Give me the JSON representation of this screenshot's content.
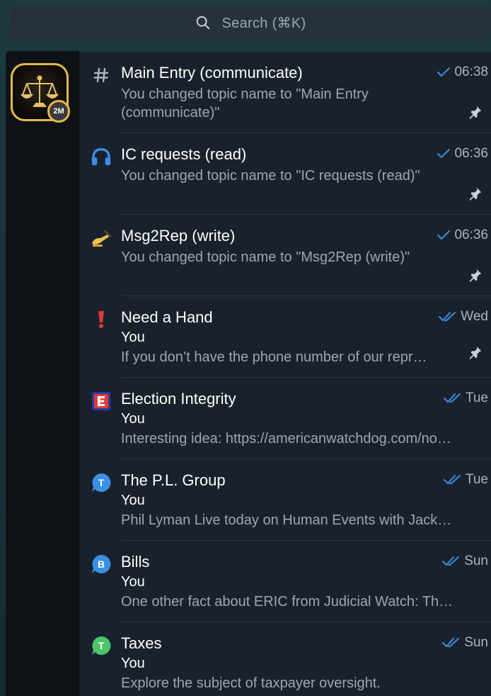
{
  "search": {
    "placeholder": "Search (⌘K)"
  },
  "sidebar": {
    "group_avatar": {
      "badge": "2M"
    }
  },
  "chats": [
    {
      "icon": "hash-icon",
      "title": "Main Entry (communicate)",
      "preview": "You changed topic name to \"Main Entry (communicate)\"",
      "time": "06:38",
      "status": "sent-single-check",
      "pinned": true
    },
    {
      "icon": "headphones-icon",
      "title": "IC requests (read)",
      "preview": "You changed topic name to \"IC requests (read)\"",
      "time": "06:36",
      "status": "sent-single-check",
      "pinned": true
    },
    {
      "icon": "writing-hand-icon",
      "title": "Msg2Rep (write)",
      "preview": "You changed topic name to \"Msg2Rep (write)\"",
      "time": "06:36",
      "status": "sent-single-check",
      "pinned": true
    },
    {
      "icon": "exclamation-icon",
      "title": "Need a Hand",
      "sender": "You",
      "message": "If you don’t have the phone number of our repr…",
      "time": "Wed",
      "status": "read-double-check",
      "pinned": true
    },
    {
      "icon": "e-letter-icon",
      "title": "Election Integrity",
      "sender": "You",
      "message": "Interesting idea: https://americanwatchdog.com/no…",
      "time": "Tue",
      "status": "read-double-check",
      "pinned": false
    },
    {
      "icon": "t-bubble-icon",
      "title": "The P.L. Group",
      "sender": "You",
      "message": "Phil Lyman Live today on Human Events with Jack…",
      "time": "Tue",
      "status": "read-double-check",
      "pinned": false
    },
    {
      "icon": "b-bubble-icon",
      "title": "Bills",
      "sender": "You",
      "message": "One other fact about ERIC from Judicial Watch:  Th…",
      "time": "Sun",
      "status": "read-double-check",
      "pinned": false
    },
    {
      "icon": "t-green-bubble-icon",
      "title": "Taxes",
      "sender": "You",
      "message": "Explore the subject of taxpayer oversight.",
      "time": "Sun",
      "status": "read-double-check",
      "pinned": false
    }
  ],
  "colors": {
    "accent_blue": "#3b8fe6",
    "time_gray": "#a9b4c0",
    "green_bubble": "#4cc46b"
  }
}
